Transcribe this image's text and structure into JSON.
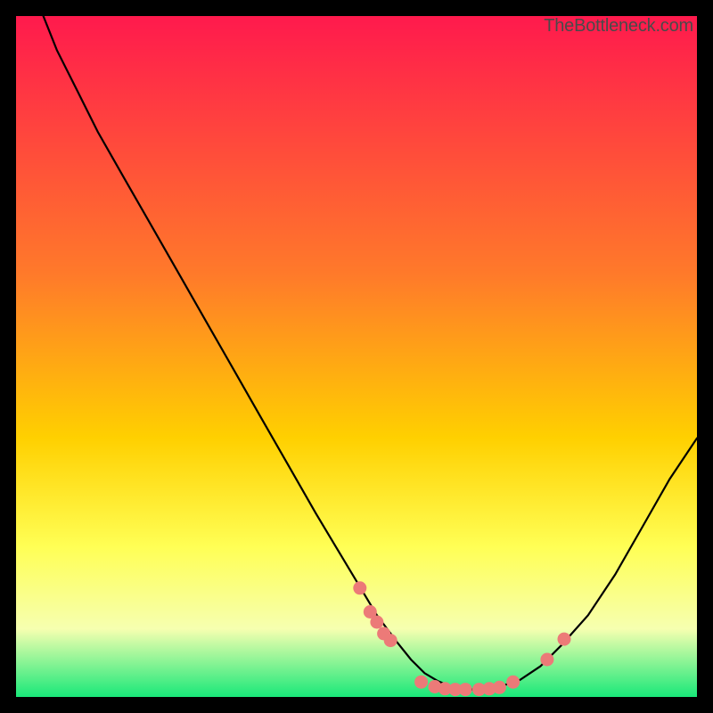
{
  "watermark": "TheBottleneck.com",
  "colors": {
    "top": "#ff1a4d",
    "mid_upper": "#ff7a2a",
    "mid": "#ffd000",
    "mid_lower": "#ffff55",
    "lower": "#f6ffb0",
    "bottom": "#19e879",
    "curve": "#000000",
    "dot": "#ec7a78",
    "dot_stroke": "#a84a48"
  },
  "chart_data": {
    "type": "line",
    "title": "",
    "xlabel": "",
    "ylabel": "",
    "xlim": [
      0,
      100
    ],
    "ylim": [
      0,
      100
    ],
    "series": [
      {
        "name": "bottleneck-curve",
        "x": [
          4,
          6,
          9,
          12,
          16,
          20,
          24,
          28,
          32,
          36,
          40,
          44,
          47,
          50,
          53,
          56,
          58,
          60,
          62,
          64,
          66,
          68,
          71,
          74,
          77,
          80,
          84,
          88,
          92,
          96,
          100
        ],
        "y": [
          100,
          95,
          89,
          83,
          76,
          69,
          62,
          55,
          48,
          41,
          34,
          27,
          22,
          17,
          12,
          8,
          5.5,
          3.5,
          2.3,
          1.5,
          1.1,
          1.1,
          1.5,
          2.5,
          4.5,
          7.5,
          12,
          18,
          25,
          32,
          38
        ]
      }
    ],
    "markers": {
      "name": "highlight-dots",
      "points": [
        {
          "x": 50.5,
          "y": 16
        },
        {
          "x": 52,
          "y": 12.5
        },
        {
          "x": 53,
          "y": 11
        },
        {
          "x": 54,
          "y": 9.3
        },
        {
          "x": 55,
          "y": 8.3
        },
        {
          "x": 59.5,
          "y": 2.2
        },
        {
          "x": 61.5,
          "y": 1.5
        },
        {
          "x": 63,
          "y": 1.2
        },
        {
          "x": 64.5,
          "y": 1.1
        },
        {
          "x": 66,
          "y": 1.1
        },
        {
          "x": 68,
          "y": 1.1
        },
        {
          "x": 69.5,
          "y": 1.2
        },
        {
          "x": 71,
          "y": 1.4
        },
        {
          "x": 73,
          "y": 2.2
        },
        {
          "x": 78,
          "y": 5.5
        },
        {
          "x": 80.5,
          "y": 8.5
        }
      ]
    }
  }
}
